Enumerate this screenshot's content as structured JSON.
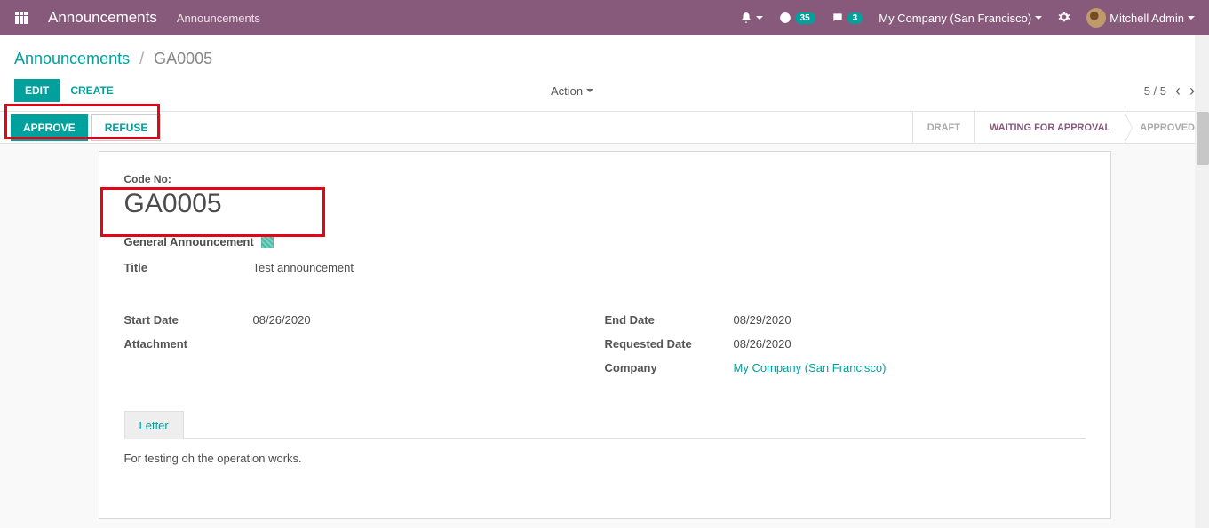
{
  "navbar": {
    "brand": "Announcements",
    "menu_item": "Announcements",
    "activity_badge": "35",
    "messages_badge": "3",
    "company": "My Company (San Francisco)",
    "user": "Mitchell Admin"
  },
  "breadcrumb": {
    "parent": "Announcements",
    "current": "GA0005"
  },
  "toolbar": {
    "edit": "Edit",
    "create": "Create",
    "action": "Action"
  },
  "pager": {
    "text": "5 / 5"
  },
  "statusbar": {
    "approve": "Approve",
    "refuse": "Refuse",
    "steps": [
      "DRAFT",
      "WAITING FOR APPROVAL",
      "APPROVED"
    ]
  },
  "form": {
    "code_label": "Code No:",
    "code_value": "GA0005",
    "general_label": "General Announcement",
    "fields": {
      "title_label": "Title",
      "title_value": "Test announcement",
      "start_date_label": "Start Date",
      "start_date_value": "08/26/2020",
      "attachment_label": "Attachment",
      "attachment_value": "",
      "end_date_label": "End Date",
      "end_date_value": "08/29/2020",
      "requested_date_label": "Requested Date",
      "requested_date_value": "08/26/2020",
      "company_label": "Company",
      "company_value": "My Company (San Francisco)"
    },
    "tab_letter": "Letter",
    "letter_body": "For testing oh the operation works."
  }
}
